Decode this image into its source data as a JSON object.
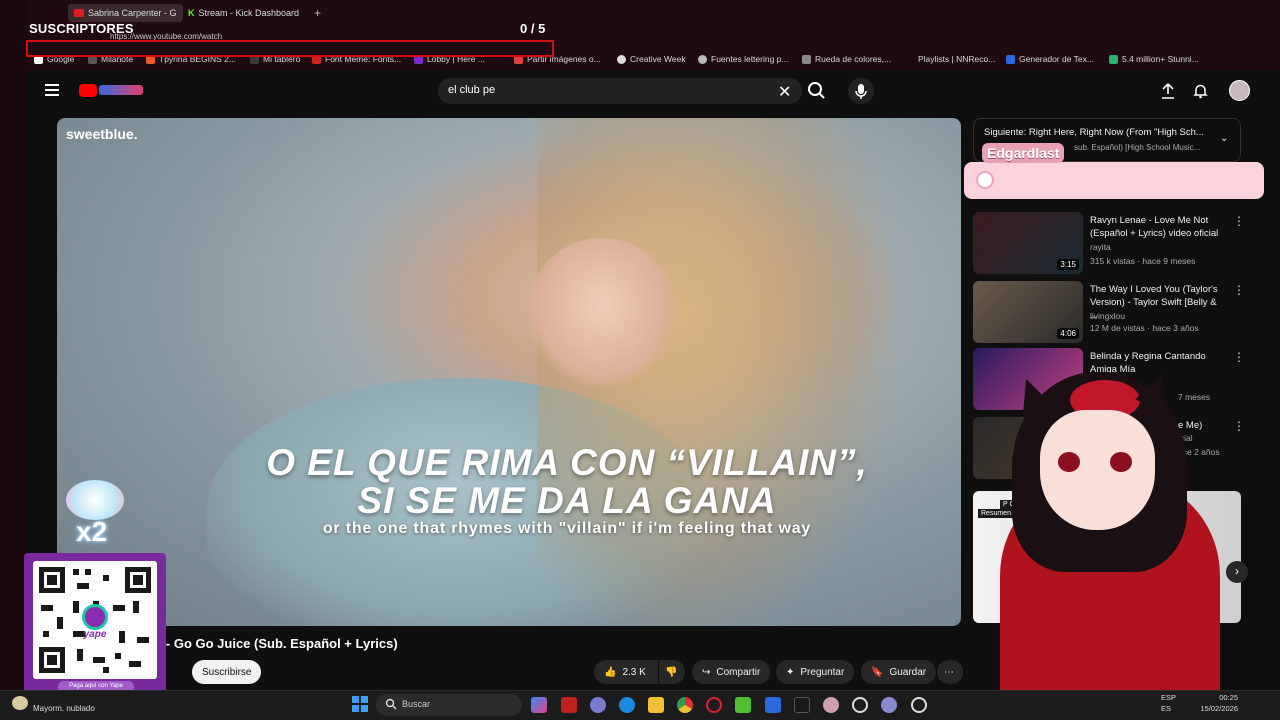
{
  "browser": {
    "tabs": [
      "Sabrina Carpenter - G",
      "Stream - Kick Dashboard"
    ],
    "new_tab_symbol": "+",
    "url": "https://www.youtube.com/watch",
    "bookmarks": [
      "Google",
      "Milanote",
      "Tpyrina BEGINS 2...",
      "Mi tablero",
      "Font Meme: Fonts...",
      "Lobby | Here ...",
      "Partir imágenes o...",
      "Creative Week",
      "Fuentes lettering p...",
      "Rueda de colores,...",
      "Playlists | NNReco...",
      "Generador de Tex...",
      "5.4 million+ Stunni..."
    ]
  },
  "overlay": {
    "subs_title": "SUSCRIPTORES",
    "subs_count": "0  / 5",
    "chat_name": "Edgardlast",
    "multiplier": "x2",
    "qr_caption": "Paga aquí con Yape",
    "qr_brand": "yape"
  },
  "youtube": {
    "search_value": "el club pe",
    "video": {
      "channel_logo": "sweetblue.",
      "lyric_line1": "O EL QUE RIMA CON “VILLAIN”,",
      "lyric_line2": "SI SE ME DA LA GANA",
      "lyric_translation": "or the one that rhymes with \"villain\" if i'm feeling that way"
    },
    "video_title": "er - Go Go Juice (Sub. Español + Lyrics)",
    "subscribe_label": "Suscribirse",
    "likes": "2.3 K",
    "share_label": "Compartir",
    "ask_label": "Preguntar",
    "save_label": "Guardar",
    "next_up": {
      "title": "Siguiente: Right Here, Right Now (From \"High Sch...",
      "sub": "sub. Español) [High School Music..."
    },
    "recommendations": [
      {
        "title": "Ravyn Lenae - Love Me Not (Español + Lyrics) video oficial",
        "channel": "rayita",
        "meta": "315 k vistas · hace 9 meses",
        "duration": "3:15"
      },
      {
        "title": "The Way I Loved You (Taylor's Version) - Taylor Swift [Belly & ...",
        "channel": "livingxlou",
        "meta": "12 M de vistas · hace 3 años",
        "duration": "4:06"
      },
      {
        "title": "Belinda y Regina Cantando Amiga Mía",
        "channel": "",
        "meta": "7 meses",
        "duration": ""
      },
      {
        "title": "e Me)",
        "channel": "icial",
        "meta": "ace 2 años",
        "duration": ""
      }
    ],
    "shorts_label": "P Club",
    "shorts_sub": "Resumen y refe"
  },
  "taskbar": {
    "search_placeholder": "Buscar",
    "weather": "Mayorm. nublado",
    "lang1": "ESP",
    "lang2": "ES",
    "time": "00:25",
    "date": "15/02/2026"
  }
}
